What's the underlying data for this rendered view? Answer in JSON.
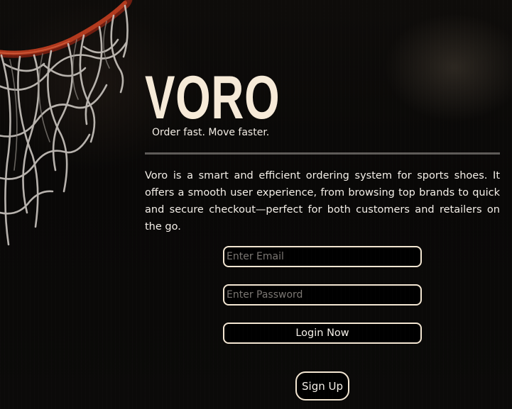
{
  "brand": {
    "name": "VORO",
    "tagline": "Order fast. Move faster."
  },
  "description": "Voro is a smart and efficient ordering system for sports shoes. It offers a smooth user experience, from browsing top brands to quick and secure checkout—perfect for both customers and retailers on the go.",
  "login_form": {
    "email_placeholder": "Enter Email",
    "password_placeholder": "Enter Password",
    "login_label": "Login Now",
    "signup_label": "Sign Up"
  },
  "colors": {
    "accent_cream": "#f3e6d2",
    "background": "#080706",
    "text": "#f4efe8",
    "hoop_rim": "#b23a1e"
  },
  "icons": {
    "background_image": "basketball-hoop-net"
  }
}
